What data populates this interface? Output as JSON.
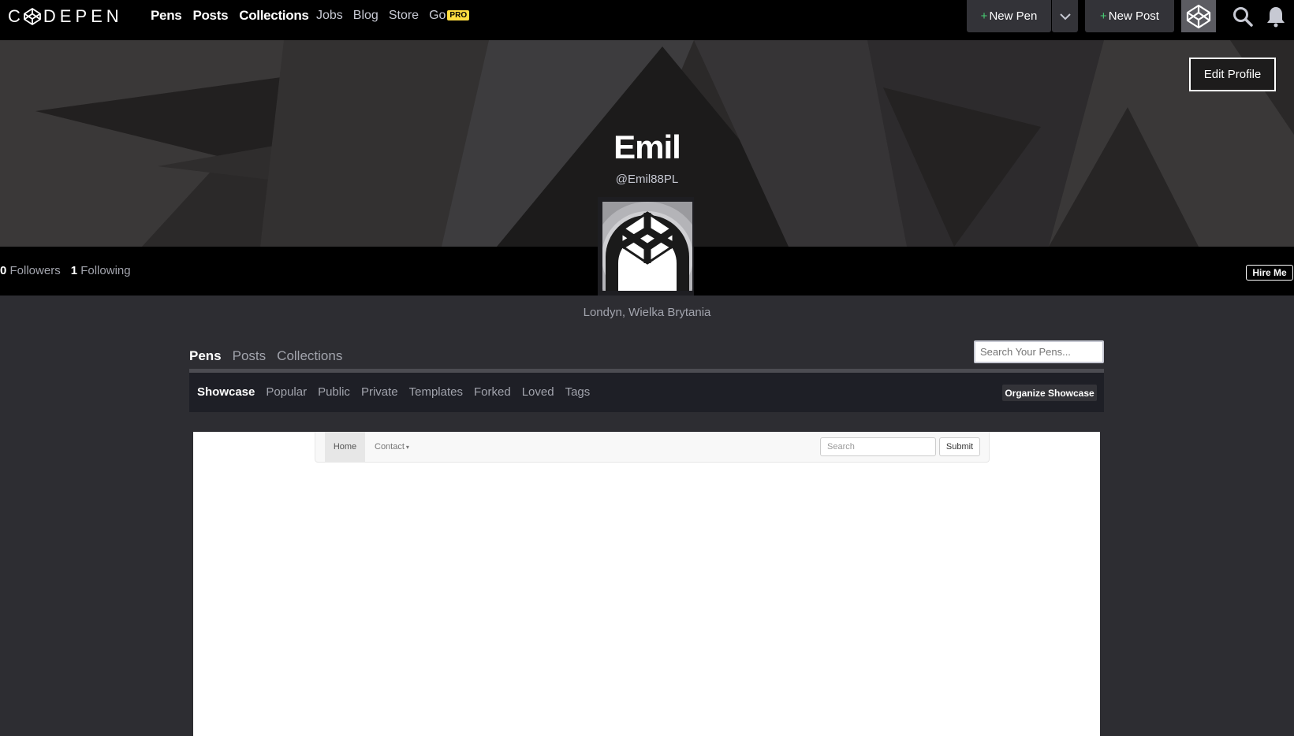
{
  "brand": {
    "logo_text": "CODEPEN",
    "logo_left": "C",
    "logo_right": "DEPEN"
  },
  "nav": {
    "main": [
      "Pens",
      "Posts",
      "Collections"
    ],
    "secondary": [
      "Jobs",
      "Blog",
      "Store",
      "Go"
    ],
    "pro_badge": "PRO",
    "new_pen": "New Pen",
    "new_post": "New Post",
    "plus": "+"
  },
  "profile": {
    "edit_label": "Edit Profile",
    "name": "Emil",
    "handle": "@Emil88PL",
    "followers_count": "0",
    "followers_label": "Followers",
    "following_count": "1",
    "following_label": "Following",
    "hire_label": "Hire Me",
    "location": "Londyn, Wielka Brytania"
  },
  "tabs": {
    "items": [
      "Pens",
      "Posts",
      "Collections"
    ],
    "active": "Pens",
    "search_placeholder": "Search Your Pens..."
  },
  "subtabs": {
    "items": [
      "Showcase",
      "Popular",
      "Public",
      "Private",
      "Templates",
      "Forked",
      "Loved",
      "Tags"
    ],
    "active": "Showcase",
    "organize_label": "Organize Showcase"
  },
  "preview": {
    "home_label": "Home",
    "contact_label": "Contact",
    "search_placeholder": "Search",
    "submit_label": "Submit"
  },
  "colors": {
    "accent_green": "#47cf73",
    "pro_yellow": "#ffdd40"
  }
}
